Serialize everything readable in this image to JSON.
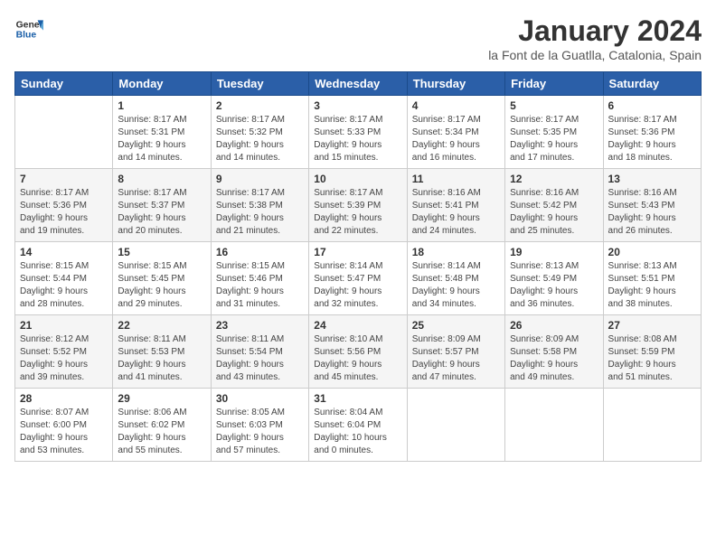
{
  "header": {
    "logo_line1": "General",
    "logo_line2": "Blue",
    "month_title": "January 2024",
    "subtitle": "la Font de la Guatlla, Catalonia, Spain"
  },
  "days_of_week": [
    "Sunday",
    "Monday",
    "Tuesday",
    "Wednesday",
    "Thursday",
    "Friday",
    "Saturday"
  ],
  "weeks": [
    [
      {
        "day": "",
        "info": ""
      },
      {
        "day": "1",
        "info": "Sunrise: 8:17 AM\nSunset: 5:31 PM\nDaylight: 9 hours\nand 14 minutes."
      },
      {
        "day": "2",
        "info": "Sunrise: 8:17 AM\nSunset: 5:32 PM\nDaylight: 9 hours\nand 14 minutes."
      },
      {
        "day": "3",
        "info": "Sunrise: 8:17 AM\nSunset: 5:33 PM\nDaylight: 9 hours\nand 15 minutes."
      },
      {
        "day": "4",
        "info": "Sunrise: 8:17 AM\nSunset: 5:34 PM\nDaylight: 9 hours\nand 16 minutes."
      },
      {
        "day": "5",
        "info": "Sunrise: 8:17 AM\nSunset: 5:35 PM\nDaylight: 9 hours\nand 17 minutes."
      },
      {
        "day": "6",
        "info": "Sunrise: 8:17 AM\nSunset: 5:36 PM\nDaylight: 9 hours\nand 18 minutes."
      }
    ],
    [
      {
        "day": "7",
        "info": "Sunrise: 8:17 AM\nSunset: 5:36 PM\nDaylight: 9 hours\nand 19 minutes."
      },
      {
        "day": "8",
        "info": "Sunrise: 8:17 AM\nSunset: 5:37 PM\nDaylight: 9 hours\nand 20 minutes."
      },
      {
        "day": "9",
        "info": "Sunrise: 8:17 AM\nSunset: 5:38 PM\nDaylight: 9 hours\nand 21 minutes."
      },
      {
        "day": "10",
        "info": "Sunrise: 8:17 AM\nSunset: 5:39 PM\nDaylight: 9 hours\nand 22 minutes."
      },
      {
        "day": "11",
        "info": "Sunrise: 8:16 AM\nSunset: 5:41 PM\nDaylight: 9 hours\nand 24 minutes."
      },
      {
        "day": "12",
        "info": "Sunrise: 8:16 AM\nSunset: 5:42 PM\nDaylight: 9 hours\nand 25 minutes."
      },
      {
        "day": "13",
        "info": "Sunrise: 8:16 AM\nSunset: 5:43 PM\nDaylight: 9 hours\nand 26 minutes."
      }
    ],
    [
      {
        "day": "14",
        "info": "Sunrise: 8:15 AM\nSunset: 5:44 PM\nDaylight: 9 hours\nand 28 minutes."
      },
      {
        "day": "15",
        "info": "Sunrise: 8:15 AM\nSunset: 5:45 PM\nDaylight: 9 hours\nand 29 minutes."
      },
      {
        "day": "16",
        "info": "Sunrise: 8:15 AM\nSunset: 5:46 PM\nDaylight: 9 hours\nand 31 minutes."
      },
      {
        "day": "17",
        "info": "Sunrise: 8:14 AM\nSunset: 5:47 PM\nDaylight: 9 hours\nand 32 minutes."
      },
      {
        "day": "18",
        "info": "Sunrise: 8:14 AM\nSunset: 5:48 PM\nDaylight: 9 hours\nand 34 minutes."
      },
      {
        "day": "19",
        "info": "Sunrise: 8:13 AM\nSunset: 5:49 PM\nDaylight: 9 hours\nand 36 minutes."
      },
      {
        "day": "20",
        "info": "Sunrise: 8:13 AM\nSunset: 5:51 PM\nDaylight: 9 hours\nand 38 minutes."
      }
    ],
    [
      {
        "day": "21",
        "info": "Sunrise: 8:12 AM\nSunset: 5:52 PM\nDaylight: 9 hours\nand 39 minutes."
      },
      {
        "day": "22",
        "info": "Sunrise: 8:11 AM\nSunset: 5:53 PM\nDaylight: 9 hours\nand 41 minutes."
      },
      {
        "day": "23",
        "info": "Sunrise: 8:11 AM\nSunset: 5:54 PM\nDaylight: 9 hours\nand 43 minutes."
      },
      {
        "day": "24",
        "info": "Sunrise: 8:10 AM\nSunset: 5:56 PM\nDaylight: 9 hours\nand 45 minutes."
      },
      {
        "day": "25",
        "info": "Sunrise: 8:09 AM\nSunset: 5:57 PM\nDaylight: 9 hours\nand 47 minutes."
      },
      {
        "day": "26",
        "info": "Sunrise: 8:09 AM\nSunset: 5:58 PM\nDaylight: 9 hours\nand 49 minutes."
      },
      {
        "day": "27",
        "info": "Sunrise: 8:08 AM\nSunset: 5:59 PM\nDaylight: 9 hours\nand 51 minutes."
      }
    ],
    [
      {
        "day": "28",
        "info": "Sunrise: 8:07 AM\nSunset: 6:00 PM\nDaylight: 9 hours\nand 53 minutes."
      },
      {
        "day": "29",
        "info": "Sunrise: 8:06 AM\nSunset: 6:02 PM\nDaylight: 9 hours\nand 55 minutes."
      },
      {
        "day": "30",
        "info": "Sunrise: 8:05 AM\nSunset: 6:03 PM\nDaylight: 9 hours\nand 57 minutes."
      },
      {
        "day": "31",
        "info": "Sunrise: 8:04 AM\nSunset: 6:04 PM\nDaylight: 10 hours\nand 0 minutes."
      },
      {
        "day": "",
        "info": ""
      },
      {
        "day": "",
        "info": ""
      },
      {
        "day": "",
        "info": ""
      }
    ]
  ]
}
